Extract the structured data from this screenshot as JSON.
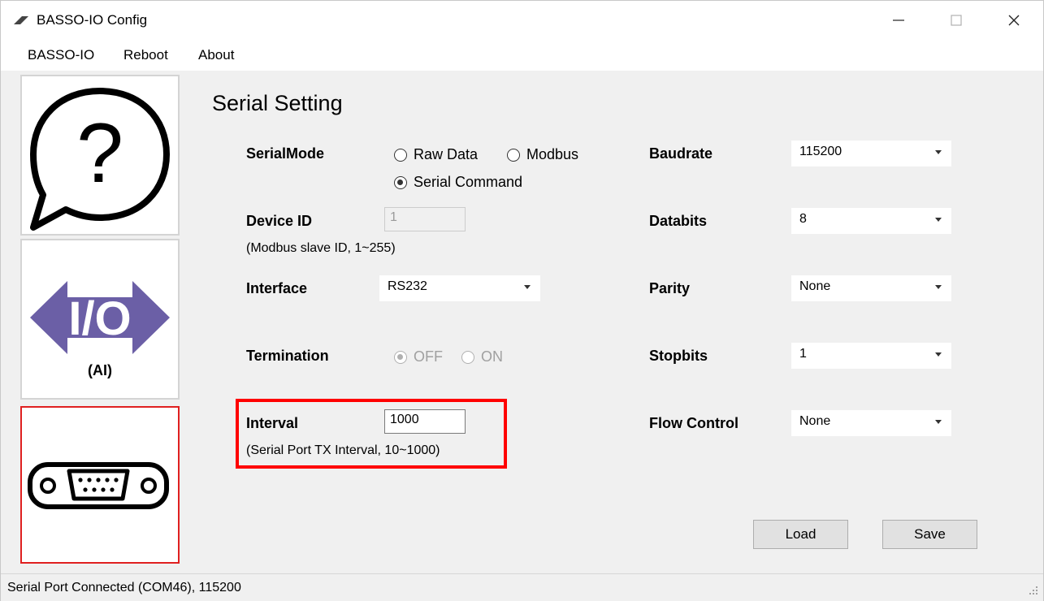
{
  "window": {
    "title": "BASSO-IO Config",
    "controls": {
      "minimize": "—",
      "maximize": "☐",
      "close": "✕"
    }
  },
  "menu": {
    "items": [
      "BASSO-IO",
      "Reboot",
      "About"
    ]
  },
  "nav": {
    "items": [
      {
        "icon": "help-speech-bubble-icon"
      },
      {
        "icon": "io-arrows-icon",
        "sub_label": "(AI)"
      },
      {
        "icon": "serial-port-connector-icon"
      }
    ]
  },
  "serial_setting": {
    "title": "Serial Setting",
    "serial_mode": {
      "label": "SerialMode",
      "options": [
        "Raw Data",
        "Modbus",
        "Serial Command"
      ],
      "selected": "Serial Command"
    },
    "device_id": {
      "label": "Device ID",
      "value": "1",
      "note": "(Modbus slave ID, 1~255)"
    },
    "interface": {
      "label": "Interface",
      "value": "RS232"
    },
    "termination": {
      "label": "Termination",
      "options": [
        "OFF",
        "ON"
      ],
      "selected": "OFF"
    },
    "interval": {
      "label": "Interval",
      "value": "1000",
      "note": "(Serial Port TX Interval, 10~1000)"
    },
    "baudrate": {
      "label": "Baudrate",
      "value": "115200"
    },
    "databits": {
      "label": "Databits",
      "value": "8"
    },
    "parity": {
      "label": "Parity",
      "value": "None"
    },
    "stopbits": {
      "label": "Stopbits",
      "value": "1"
    },
    "flow_control": {
      "label": "Flow Control",
      "value": "None"
    },
    "buttons": {
      "load": "Load",
      "save": "Save"
    }
  },
  "status_bar": {
    "text": "Serial Port Connected (COM46), 115200"
  },
  "colors": {
    "highlight": "#ff0000",
    "io_icon": "#6b5fa6",
    "active_nav_border": "#e02020"
  }
}
